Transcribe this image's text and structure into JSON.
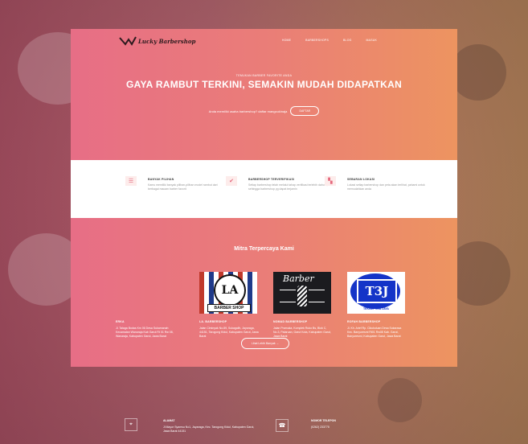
{
  "brand": {
    "name": "Lucky Barbershop",
    "accent": "#e96f7f",
    "accent2": "#ee945f"
  },
  "nav": [
    "HOME",
    "BARBERSHOPS",
    "BLOG",
    "MASUK"
  ],
  "hero": {
    "tagline": "TEMUKAN BARBER FAVORITE ANDA",
    "headline": "GAYA RAMBUT TERKINI, SEMAKIN MUDAH DIDAPATKAN",
    "subtext": "Anda memiliki usaha barbershop? daftar mangcukinaja",
    "cta": "DAFTAR"
  },
  "features": [
    {
      "icon": "list-icon",
      "title": "BANYAK PILIHAN",
      "desc": "Kamu memiliki banyak pilihan-pilihan model rambut dari berbagai macam barber favorit"
    },
    {
      "icon": "check-icon",
      "title": "BARBERSHOP TERVERIFIKASI",
      "desc": "Setiap barbershop telah melalui tahap verifikasi terlebih dahulu, sehingga barbershop yg dapat terjamin"
    },
    {
      "icon": "map-icon",
      "title": "SEBARAN LOKASI",
      "desc": "Lokasi setiap barbershop dan peta akan terlihat, pahami untuk memudahkan anda"
    }
  ],
  "partners": {
    "title": "Mitra Terpercaya Kami",
    "items": [
      {
        "name": "ERKA",
        "address": "Jl. Talaga Bodas Km 06 Desa Sukamanah Kecamatan Wanaraja Kab Garut Rt 01 Rw 08, Wanaraja, Kabupaten Garut, Jawa Barat"
      },
      {
        "name": "LA. BARBERSHOP",
        "address": "Jalan Ciminyak No.89, Sukagalih, Jayaraga, 44151, Tarogong Kidul, Kabupaten Garut, Jawa Barat"
      },
      {
        "name": "NOMAD BARBERSHOP",
        "address": "Jalan Pramuka, Komplek Ruko Bs, Blok C, No.3, Pataruan, Garut Kota, Kabupaten Garut, Jawa Barat"
      },
      {
        "name": "ROFAH BARBERSHOP",
        "address": "Jl. Kh. Arief Rp. Cikukuluan Desa Sukarasa Kec. Banyuresmi Rt01 Rw08 Kab. Garut, Banyuresmi, Kabupaten Garut, Jawa Barat"
      }
    ],
    "logo_texts": {
      "la_main": "LA",
      "la_band": "BARBER SHOP",
      "nomad_script": "Barber",
      "t3j_main": "T3J",
      "t3j_caption": "TEKNIK TIGA JAYA"
    },
    "more": "Lihat Lebih Banyak →"
  },
  "contact": {
    "address_title": "ALAMAT",
    "address": "Jl Mayor Syamsu No1, Jayaraga, Kec. Tarogong Kidul, Kabupaten Garut, Jawa Barat 44151",
    "phone_title": "NOMOR TELEPON",
    "phone": "(0262) 233775"
  }
}
